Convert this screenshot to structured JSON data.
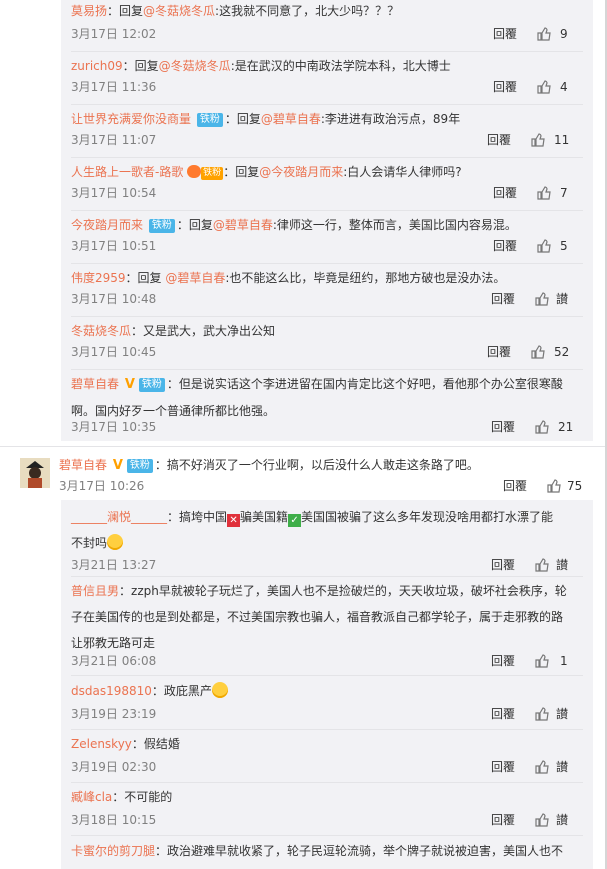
{
  "reply_label": "回覆",
  "like_label": "讃",
  "block1": [
    {
      "user": "莫易扬",
      "parts": [
        [
          "p",
          "：回复"
        ],
        [
          "a",
          "@冬菇烧冬瓜"
        ],
        [
          "p",
          ":这我就不同意了，北大少吗？？？"
        ]
      ],
      "time": "3月17日 12:02",
      "likes": "9"
    },
    {
      "user": "zurich09",
      "parts": [
        [
          "p",
          "：回复"
        ],
        [
          "a",
          "@冬菇烧冬瓜"
        ],
        [
          "p",
          ":是在武汉的中南政法学院本科，北大博士"
        ]
      ],
      "time": "3月17日 11:36",
      "likes": "4"
    },
    {
      "user": "让世界充满爱你没商量",
      "badge": "铁粉",
      "parts": [
        [
          "p",
          "：回复"
        ],
        [
          "a",
          "@碧草自春"
        ],
        [
          "p",
          ":李进进有政治污点，89年"
        ]
      ],
      "time": "3月17日 11:07",
      "likes": "11"
    },
    {
      "user": "人生路上一歌者-路歌",
      "special": "铁粉",
      "parts": [
        [
          "p",
          "：回复"
        ],
        [
          "a",
          "@今夜踏月而来"
        ],
        [
          "p",
          ":白人会请华人律师吗?"
        ]
      ],
      "time": "3月17日 10:54",
      "likes": "7"
    },
    {
      "user": "今夜踏月而来",
      "badge": "铁粉",
      "parts": [
        [
          "p",
          "：回复"
        ],
        [
          "a",
          "@碧草自春"
        ],
        [
          "p",
          ":律师这一行，整体而言，美国比国内容易混。"
        ]
      ],
      "time": "3月17日 10:51",
      "likes": "5"
    },
    {
      "user": "伟度2959",
      "parts": [
        [
          "p",
          "：回复 "
        ],
        [
          "a",
          "@碧草自春"
        ],
        [
          "p",
          ":也不能这么比，毕竟是纽约，那地方破也是没办法。"
        ]
      ],
      "time": "3月17日 10:48",
      "likes": ""
    },
    {
      "user": "冬菇烧冬瓜",
      "parts": [
        [
          "p",
          "：又是武大，武大净出公知"
        ]
      ],
      "time": "3月17日 10:45",
      "likes": "52"
    },
    {
      "user": "碧草自春",
      "vip": true,
      "badge": "铁粉",
      "parts": [
        [
          "p",
          "：但是说实话这个李进进留在国内肯定比这个好吧，看他那个办公室很寒酸"
        ]
      ],
      "line2": "啊。国内好歹一个普通律所都比他强。",
      "time": "3月17日 10:35",
      "likes": "21"
    }
  ],
  "top": {
    "user": "碧草自春",
    "badge": "铁粉",
    "text": "：搞不好消灭了一个行业啊，以后没什么人敢走这条路了吧。",
    "time": "3月17日 10:26",
    "likes": "75"
  },
  "block2": [
    {
      "user": "______澜悦______",
      "text1a": "：搞垮中国",
      "text1b": "骗美国籍",
      "text1c": "美国国被骗了这么多年发现没啥用都打水漂了能",
      "line2": "不封吗",
      "time": "3月21日 13:27",
      "likes": ""
    },
    {
      "user": "普信且男",
      "text": "：zzph早就被轮子玩烂了，美国人也不是捡破烂的，天天收垃圾，破坏社会秩序，轮",
      "line2": "子在美国传的也是到处都是，不过美国宗教也骗人，福音教派自己都学轮子，属于走邪教的路",
      "line3": "让邪教无路可走",
      "time": "3月21日 06:08",
      "likes": "1"
    },
    {
      "user": "dsdas198810",
      "text": "：政庇黑产",
      "emoji": true,
      "time": "3月19日 23:19",
      "likes": ""
    },
    {
      "user": "Zelenskyy",
      "text": "：假结婚",
      "time": "3月19日 02:30",
      "likes": ""
    },
    {
      "user": "臧峰cla",
      "text": "：不可能的",
      "time": "3月18日 10:15",
      "likes": ""
    },
    {
      "user": "卡蜜尔的剪刀腿",
      "text": "：政治避难早就收紧了，轮子民逗轮流骑，举个牌子就说被迫害，美国人也不"
    }
  ],
  "colors": {
    "username": "#eb7350",
    "badge": "#4ab5e8",
    "panel": "#f2f2f5",
    "time": "#808080"
  },
  "icons": [
    "thumbs-up-icon",
    "vip-v-icon",
    "crown-icon",
    "cross-mark-icon",
    "check-mark-icon",
    "smiley-emoji-icon"
  ]
}
